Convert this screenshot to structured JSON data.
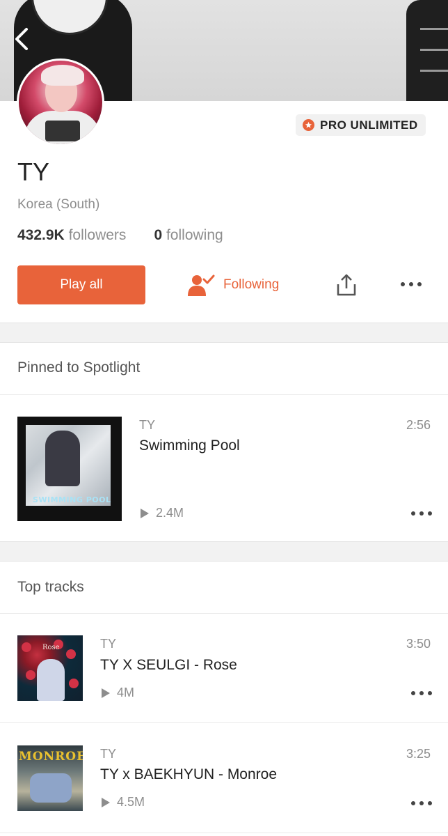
{
  "profile": {
    "name": "TY",
    "location": "Korea (South)",
    "followers_count": "432.9K",
    "followers_label": "followers",
    "following_count": "0",
    "following_label": "following",
    "badge": "PRO UNLIMITED"
  },
  "actions": {
    "play_all": "Play all",
    "following": "Following"
  },
  "spotlight": {
    "section_title": "Pinned to Spotlight",
    "track": {
      "artist": "TY",
      "title": "Swimming Pool",
      "duration": "2:56",
      "plays": "2.4M",
      "cover_text": "SWIMMING POOL"
    }
  },
  "top_tracks": {
    "section_title": "Top tracks",
    "items": [
      {
        "artist": "TY",
        "title": "TY X SEULGI - Rose",
        "duration": "3:50",
        "plays": "4M",
        "cover_text": "Rose"
      },
      {
        "artist": "TY",
        "title": "TY x BAEKHYUN - Monroe",
        "duration": "3:25",
        "plays": "4.5M",
        "cover_text": "MONROE"
      }
    ]
  },
  "colors": {
    "accent": "#e8633a",
    "muted_text": "#8d8d8d"
  },
  "icons": {
    "back": "chevron-left-icon",
    "badge_star": "star-icon",
    "following": "user-check-icon",
    "share": "share-icon",
    "more": "more-horizontal-icon",
    "play": "play-icon"
  }
}
